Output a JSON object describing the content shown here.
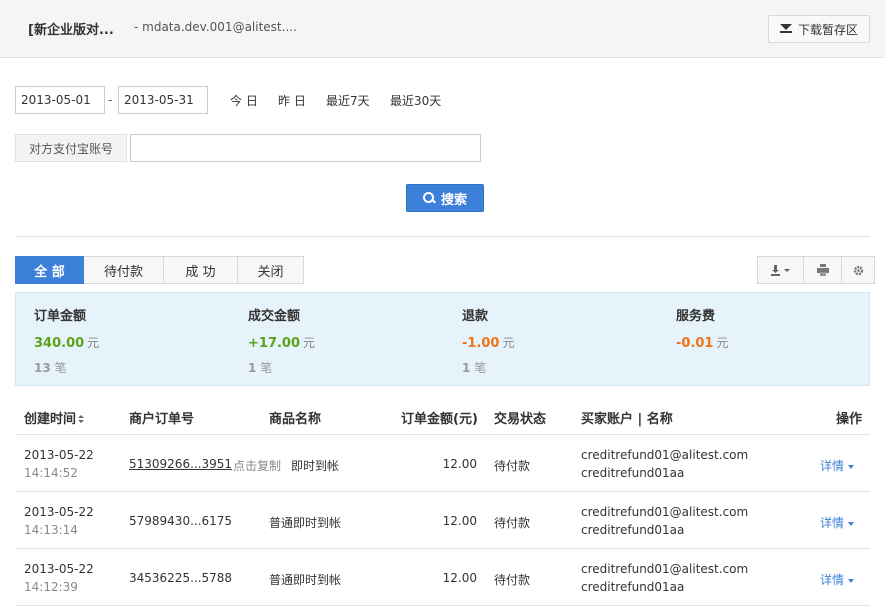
{
  "header": {
    "company": "[新企业版对...",
    "account": "- mdata.dev.001@alitest....",
    "download_label": "下载暂存区"
  },
  "filters": {
    "start_date": "2013-05-01",
    "date_separator": "-",
    "end_date": "2013-05-31",
    "quick_ranges": [
      "今 日",
      "昨 日",
      "最近7天",
      "最近30天"
    ],
    "account_label": "对方支付宝账号",
    "account_value": "",
    "search_label": "搜索"
  },
  "tabs": [
    "全 部",
    "待付款",
    "成 功",
    "关闭"
  ],
  "active_tab": 0,
  "toolbar_icons": [
    "export-icon",
    "print-icon",
    "settings-icon"
  ],
  "summary": [
    {
      "title": "订单金额",
      "amount": "340.00",
      "unit": "元",
      "count": "13",
      "count_unit": "笔",
      "color": "#5ba317"
    },
    {
      "title": "成交金额",
      "amount": "+17.00",
      "unit": "元",
      "count": "1",
      "count_unit": "笔",
      "color": "#5ba317"
    },
    {
      "title": "退款",
      "amount": "-1.00",
      "unit": "元",
      "count": "1",
      "count_unit": "笔",
      "color": "#f0731a"
    },
    {
      "title": "服务费",
      "amount": "-0.01",
      "unit": "元",
      "count": "",
      "count_unit": "",
      "color": "#f0731a"
    }
  ],
  "table": {
    "headers": [
      "创建时间",
      "商户订单号",
      "商品名称",
      "订单金额(元)",
      "交易状态",
      "买家账户 | 名称",
      "操作"
    ],
    "rows": [
      {
        "date": "2013-05-22",
        "time": "14:14:52",
        "order_no": "51309266...3951",
        "copy_hint": "点击复制",
        "goods": "即时到帐",
        "amount": "12.00",
        "status": "待付款",
        "buyer_account": "creditrefund01@alitest.com",
        "buyer_name": "creditrefund01aa",
        "action": "详情"
      },
      {
        "date": "2013-05-22",
        "time": "14:13:14",
        "order_no": "57989430...6175",
        "copy_hint": "",
        "goods": "普通即时到帐",
        "amount": "12.00",
        "status": "待付款",
        "buyer_account": "creditrefund01@alitest.com",
        "buyer_name": "creditrefund01aa",
        "action": "详情"
      },
      {
        "date": "2013-05-22",
        "time": "14:12:39",
        "order_no": "34536225...5788",
        "copy_hint": "",
        "goods": "普通即时到帐",
        "amount": "12.00",
        "status": "待付款",
        "buyer_account": "creditrefund01@alitest.com",
        "buyer_name": "creditrefund01aa",
        "action": "详情"
      }
    ]
  }
}
